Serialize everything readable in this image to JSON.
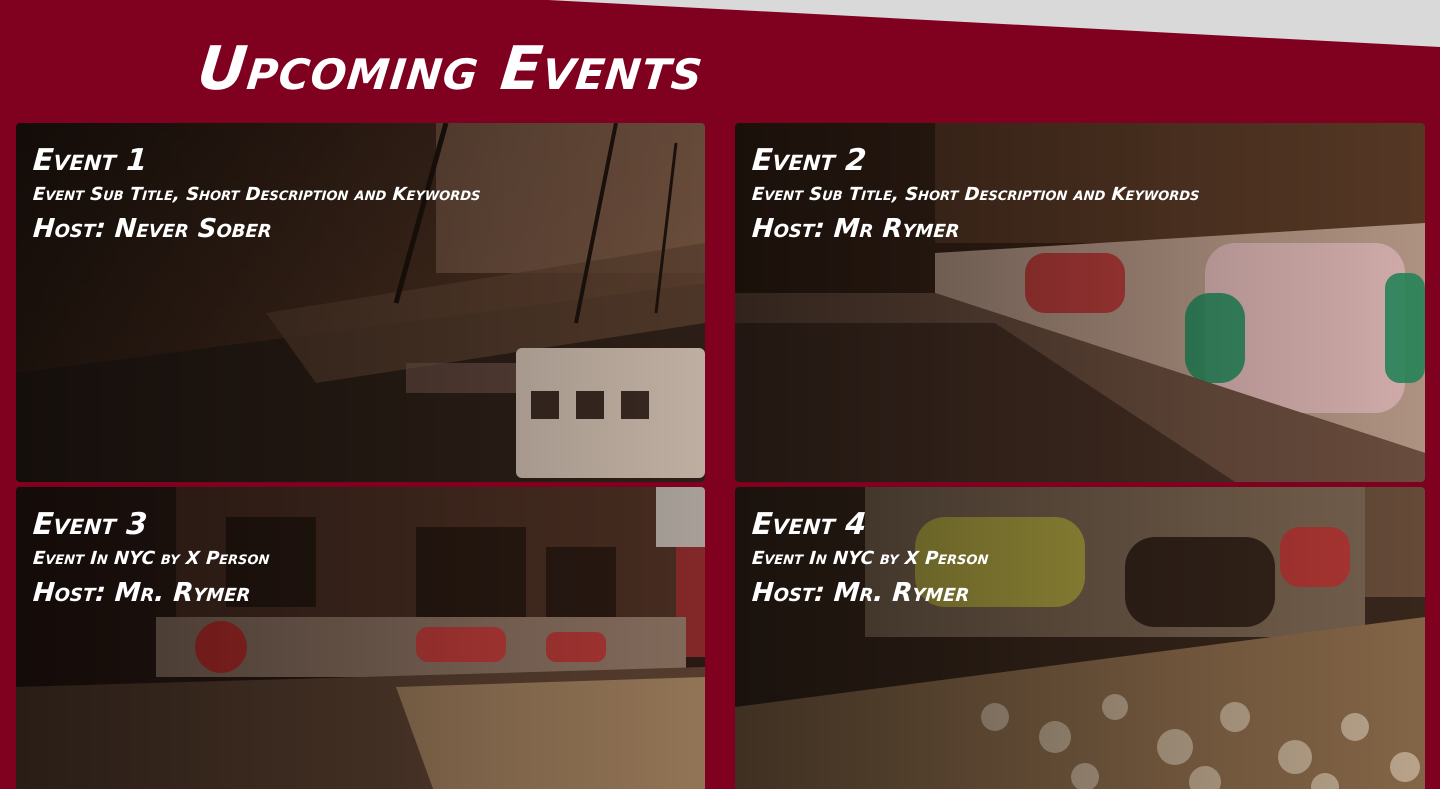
{
  "section": {
    "title": "Upcoming Events"
  },
  "events": [
    {
      "title": "Event 1",
      "subtitle": "Event Sub Title, Short Description and Keywords",
      "host": "Host: Never Sober"
    },
    {
      "title": "Event 2",
      "subtitle": "Event Sub Title, Short Description and Keywords",
      "host": "Host: Mr Rymer"
    },
    {
      "title": "Event 3",
      "subtitle": "Event In NYC by X Person",
      "host": "Host: Mr. Rymer"
    },
    {
      "title": "Event 4",
      "subtitle": "Event In NYC by X Person",
      "host": "Host: Mr. Rymer"
    }
  ],
  "colors": {
    "background": "#80001f",
    "top_band": "#d9d9d9",
    "text": "#ffffff"
  }
}
